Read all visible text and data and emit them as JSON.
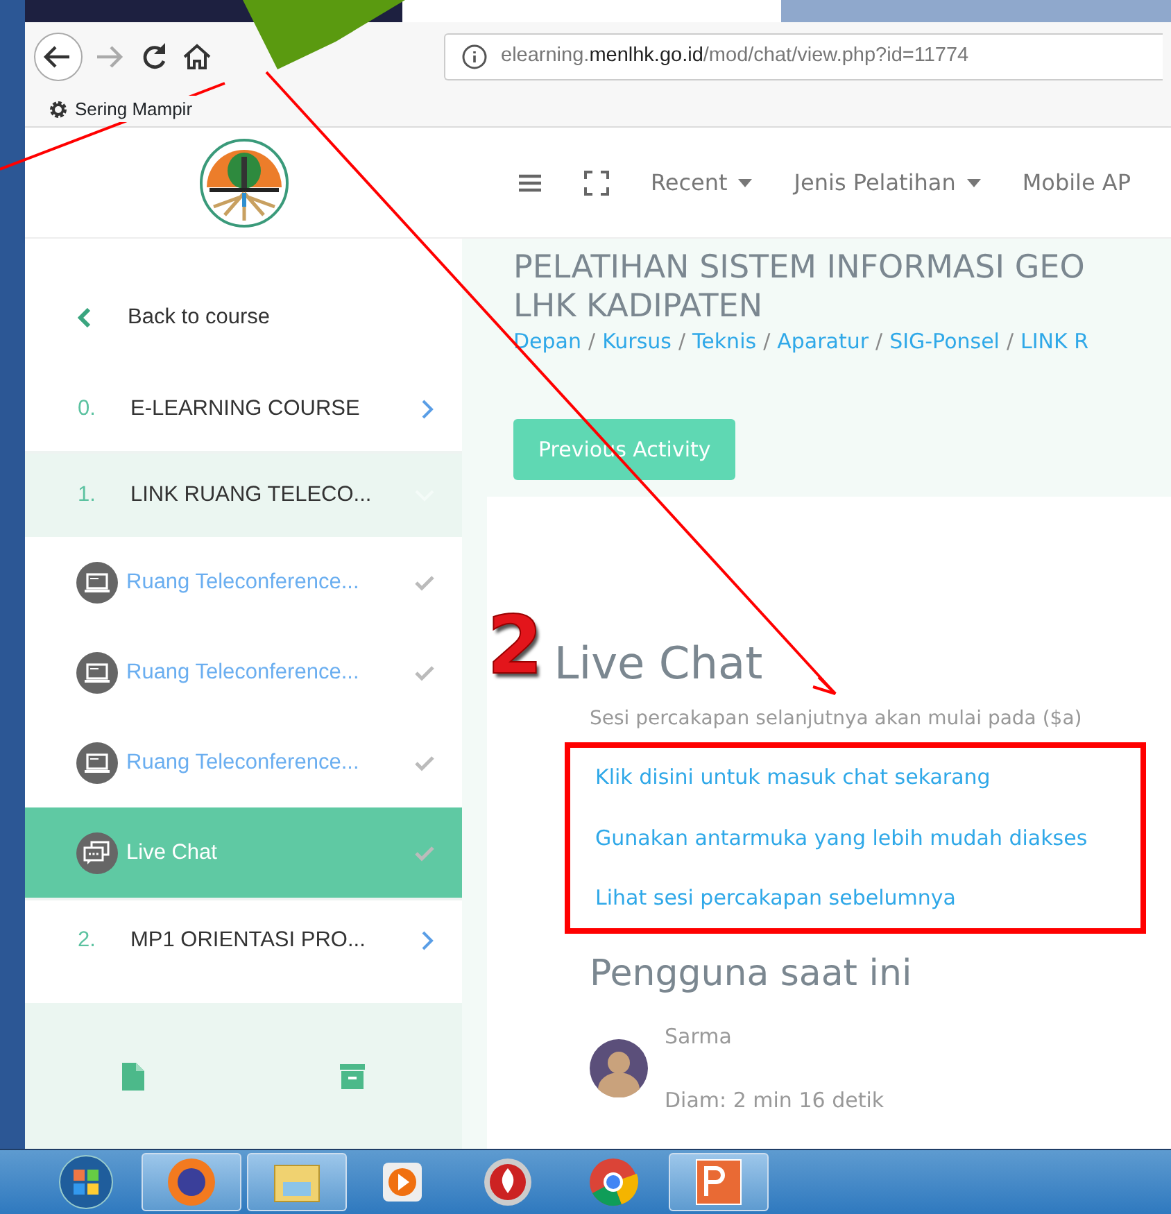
{
  "browser": {
    "address": {
      "prefix": "elearning.",
      "host": "menlhk.go.id",
      "path": "/mod/chat/view.php?id=11774"
    },
    "bookmarks": [
      {
        "label": "Sering Mampir"
      }
    ]
  },
  "site_nav": [
    {
      "label": "Recent",
      "dropdown": true
    },
    {
      "label": "Jenis Pelatihan",
      "dropdown": true
    },
    {
      "label": "Mobile AP",
      "dropdown": false
    }
  ],
  "sidebar": {
    "back_link": "Back to course",
    "sections": [
      {
        "number": "0.",
        "title": "E-LEARNING COURSE",
        "expanded": false
      },
      {
        "number": "1.",
        "title": "LINK RUANG TELECO...",
        "expanded": true,
        "children": [
          {
            "kind": "teleconference",
            "title": "Ruang Teleconference...",
            "completed": true,
            "selected": false
          },
          {
            "kind": "teleconference",
            "title": "Ruang Teleconference...",
            "completed": true,
            "selected": false
          },
          {
            "kind": "teleconference",
            "title": "Ruang Teleconference...",
            "completed": true,
            "selected": false
          },
          {
            "kind": "chat",
            "title": "Live Chat",
            "completed": true,
            "selected": true
          }
        ]
      },
      {
        "number": "2.",
        "title": "MP1 ORIENTASI PRO...",
        "expanded": false
      }
    ]
  },
  "page_header": {
    "title_lines": [
      "PELATIHAN SISTEM INFORMASI GEO",
      "LHK KADIPATEN"
    ],
    "breadcrumb": [
      "Depan",
      "Kursus",
      "Teknis",
      "Aparatur",
      "SIG-Ponsel",
      "LINK R"
    ],
    "breadcrumb_separator": "/"
  },
  "previous_button": "Previous Activity",
  "chat": {
    "step_number": "2",
    "heading": "Live Chat",
    "note": "Sesi percakapan selanjutnya akan mulai pada ($a)",
    "links": [
      "Klik disini untuk masuk chat sekarang",
      "Gunakan antarmuka yang lebih mudah diakses",
      "Lihat sesi percakapan sebelumnya"
    ],
    "users_heading": "Pengguna saat ini",
    "users": [
      {
        "name": "Sarma",
        "idle": "Diam: 2 min 16 detik"
      }
    ]
  },
  "taskbar": [
    {
      "kind": "start",
      "running": false
    },
    {
      "kind": "firefox",
      "running": true
    },
    {
      "kind": "folder",
      "running": true
    },
    {
      "kind": "media",
      "running": false
    },
    {
      "kind": "burner",
      "running": false
    },
    {
      "kind": "chrome",
      "running": false
    },
    {
      "kind": "powerpoint",
      "running": true
    }
  ]
}
